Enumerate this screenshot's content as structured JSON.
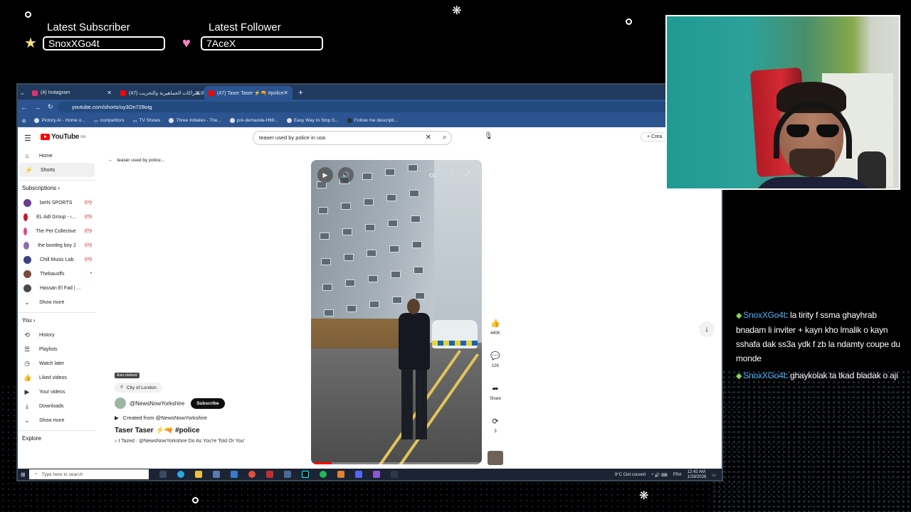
{
  "overlay": {
    "latest_subscriber": {
      "title": "Latest Subscriber",
      "value": "SnoxXGo4t",
      "icon": "star-icon",
      "icon_color": "#f5e27a"
    },
    "latest_follower": {
      "title": "Latest Follower",
      "value": "7AceX",
      "icon": "heart-icon",
      "icon_color": "#ff7fc4"
    }
  },
  "browser": {
    "tabs": [
      {
        "label": "(4) Instagram",
        "color": "#e1306c"
      },
      {
        "label": "(47) الاشتراكات الجماهيرية والتخريب...",
        "color": "#ff0000"
      },
      {
        "label": "(47) Taser Taser ⚡🔫 #police",
        "color": "#ff0000"
      }
    ],
    "url": "youtube.com/shorts/uy3On728oIg",
    "bookmarks": [
      "Pictory.AI - Home o...",
      "competitors",
      "TV Shows",
      "Three Initiates - The...",
      "pré-demande-H69...",
      "Easy Way to Stop S...",
      "Follow me descripti..."
    ]
  },
  "youtube": {
    "logo": "YouTube",
    "logo_region": "MA",
    "search_value": "teaser used by police in usa",
    "create_label": "Crea",
    "nav": [
      {
        "icon": "home-icon",
        "glyph": "⌂",
        "label": "Home"
      },
      {
        "icon": "shorts-icon",
        "glyph": "⚡",
        "label": "Shorts"
      }
    ],
    "subscriptions_label": "Subscriptions  ›",
    "subscriptions": [
      {
        "label": "beIN SPORTS",
        "color": "#6a3c8e",
        "live": "((•))"
      },
      {
        "label": "EL Adl Group - ‹...",
        "color": "#c81d25",
        "live": "((•))"
      },
      {
        "label": "The Pet Collective",
        "color": "#e04a8e",
        "live": "((•))"
      },
      {
        "label": "the bootleg boy 2",
        "color": "#8a6fb0",
        "live": "((•))"
      },
      {
        "label": "Chill Music Lab",
        "color": "#3a3f86",
        "live": "((•))"
      },
      {
        "label": "Thebausffs",
        "color": "#7a4a3a",
        "live": "•"
      },
      {
        "label": "Hassan El Fad | ...",
        "color": "#4a4a4a",
        "live": ""
      }
    ],
    "show_more": "Show more",
    "you_label": "You  ›",
    "you_items": [
      {
        "icon": "history-icon",
        "glyph": "⟲",
        "label": "History"
      },
      {
        "icon": "playlists-icon",
        "glyph": "☰",
        "label": "Playlists"
      },
      {
        "icon": "watch-later-icon",
        "glyph": "◷",
        "label": "Watch later"
      },
      {
        "icon": "liked-icon",
        "glyph": "👍",
        "label": "Liked videos"
      },
      {
        "icon": "your-videos-icon",
        "glyph": "▶",
        "label": "Your videos"
      },
      {
        "icon": "downloads-icon",
        "glyph": "⤓",
        "label": "Downloads"
      }
    ],
    "show_more_2": "Show more",
    "explore_label": "Explore",
    "back_label": "teaser used by police...",
    "short": {
      "badge": "Auto-dubbed",
      "location": "City of London",
      "channel": "@NewsNowYorkshire",
      "subscribe": "Subscribe",
      "created_from": "Created from @NewsNowYorkshire",
      "title": "Taser Taser ⚡🔫 #police",
      "music": "t Tazed · @NewsNowYorkshire   Do As You're Told Or You'",
      "progress": 0.12,
      "likes": "440K",
      "comments": "12K",
      "share": "Share",
      "remix": "3"
    }
  },
  "taskbar": {
    "search_placeholder": "Type here to search",
    "weather": "9°C  Ciel couvert",
    "lang": "FRA",
    "time": "12:42 AM",
    "date": "1/19/2026"
  },
  "chat": [
    {
      "user": "SnoxXGo4t",
      "text": ": la tirity f ssma ghayhrab bnadam li inviter + kayn kho lmalik o kayn sshafa dak ss3a ydk f zb la ndamty coupe du monde"
    },
    {
      "user": "SnoxXGo4t",
      "text": ": ghaykolak ta tkad bladak o aji"
    }
  ]
}
